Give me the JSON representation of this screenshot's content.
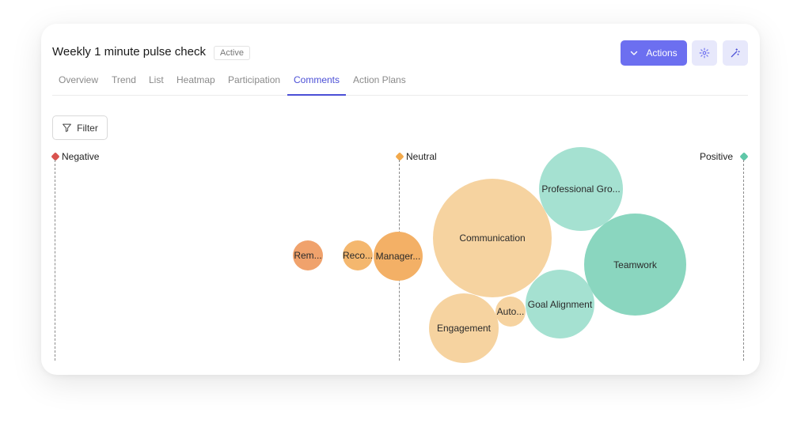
{
  "header": {
    "title": "Weekly 1 minute pulse check",
    "status_badge": "Active",
    "actions_label": "Actions"
  },
  "tabs": [
    {
      "label": "Overview"
    },
    {
      "label": "Trend"
    },
    {
      "label": "List"
    },
    {
      "label": "Heatmap"
    },
    {
      "label": "Participation"
    },
    {
      "label": "Comments",
      "active": true
    },
    {
      "label": "Action Plans"
    }
  ],
  "filter": {
    "label": "Filter"
  },
  "axis": {
    "negative": "Negative",
    "neutral": "Neutral",
    "positive": "Positive"
  },
  "colors": {
    "accent": "#6c6ff0",
    "negative": "#d9534f",
    "neutral": "#f2a94b",
    "positive": "#5fc7a8"
  },
  "bubbles": [
    {
      "label": "Rem...",
      "color": "#f0a26c"
    },
    {
      "label": "Reco...",
      "color": "#f4b76e"
    },
    {
      "label": "Manager...",
      "color": "#f3b066"
    },
    {
      "label": "Communication",
      "color": "#f6d3a0"
    },
    {
      "label": "Professional Gro...",
      "color": "#a5e1d1"
    },
    {
      "label": "Teamwork",
      "color": "#8ad6bf"
    },
    {
      "label": "Goal Alignment",
      "color": "#a5e1d1"
    },
    {
      "label": "Auto...",
      "color": "#f6d3a0"
    },
    {
      "label": "Engagement",
      "color": "#f6d3a0"
    }
  ]
}
